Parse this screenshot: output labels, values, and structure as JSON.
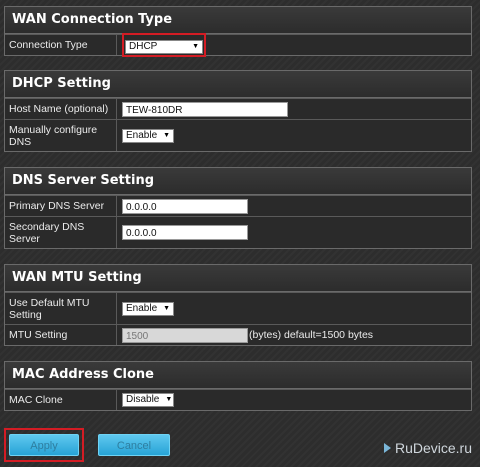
{
  "wan_connection": {
    "title": "WAN Connection Type",
    "connection_type_label": "Connection Type",
    "connection_type_value": "DHCP"
  },
  "dhcp": {
    "title": "DHCP Setting",
    "host_name_label": "Host Name (optional)",
    "host_name_value": "TEW-810DR",
    "manual_dns_label": "Manually configure DNS",
    "manual_dns_value": "Enable"
  },
  "dns": {
    "title": "DNS Server Setting",
    "primary_label": "Primary DNS Server",
    "primary_value": "0.0.0.0",
    "secondary_label": "Secondary DNS Server",
    "secondary_value": "0.0.0.0"
  },
  "mtu": {
    "title": "WAN MTU Setting",
    "use_default_label": "Use Default MTU Setting",
    "use_default_value": "Enable",
    "mtu_label": "MTU Setting",
    "mtu_value": "1500",
    "mtu_suffix": "(bytes) default=1500 bytes"
  },
  "mac": {
    "title": "MAC Address Clone",
    "clone_label": "MAC Clone",
    "clone_value": "Disable"
  },
  "buttons": {
    "apply": "Apply",
    "cancel": "Cancel"
  },
  "watermark": "RuDevice.ru",
  "colors": {
    "highlight": "#d41c24",
    "button": "#27a3d6",
    "section_bg": "#2a2a2a"
  }
}
